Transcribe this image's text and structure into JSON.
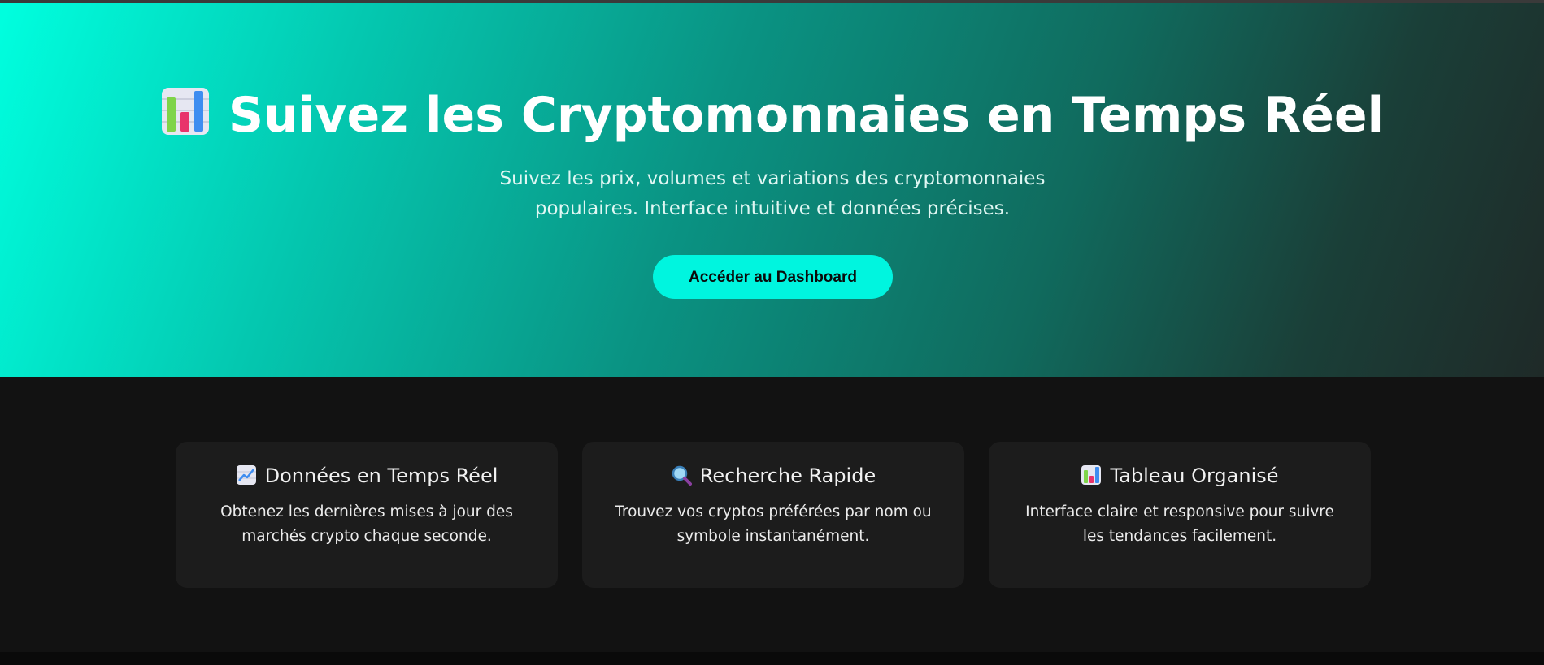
{
  "hero": {
    "title_icon": "bar-chart-emoji-icon",
    "title": "Suivez les Cryptomonnaies en Temps Réel",
    "subtitle": "Suivez les prix, volumes et variations des cryptomonnaies populaires. Interface intuitive et données précises.",
    "cta_label": "Accéder au Dashboard",
    "accent_color": "#00f5df"
  },
  "features": [
    {
      "icon": "chart-increasing-emoji-icon",
      "title": "Données en Temps Réel",
      "description": "Obtenez les dernières mises à jour des marchés crypto chaque seconde."
    },
    {
      "icon": "magnifying-glass-emoji-icon",
      "title": "Recherche Rapide",
      "description": "Trouvez vos cryptos préférées par nom ou symbole instantanément."
    },
    {
      "icon": "bar-chart-emoji-icon",
      "title": "Tableau Organisé",
      "description": "Interface claire et responsive pour suivre les tendances facilement."
    }
  ]
}
